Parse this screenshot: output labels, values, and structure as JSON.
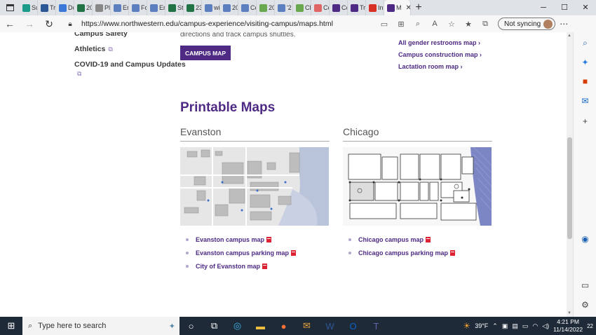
{
  "browser": {
    "tabs": [
      {
        "label": "Su",
        "color": "#1a9b8a"
      },
      {
        "label": "Tri",
        "color": "#2b5797"
      },
      {
        "label": "Dc",
        "color": "#3c78d8"
      },
      {
        "label": "20",
        "color": "#217346"
      },
      {
        "label": "Pl",
        "color": "#888888"
      },
      {
        "label": "En",
        "color": "#5b7fbf"
      },
      {
        "label": "Fo",
        "color": "#5b7fbf"
      },
      {
        "label": "En",
        "color": "#5b7fbf"
      },
      {
        "label": "St",
        "color": "#217346"
      },
      {
        "label": "23",
        "color": "#217346"
      },
      {
        "label": "wi",
        "color": "#5b7fbf"
      },
      {
        "label": "20",
        "color": "#5b7fbf"
      },
      {
        "label": "Cc",
        "color": "#5b7fbf"
      },
      {
        "label": "20",
        "color": "#6aa84f"
      },
      {
        "label": "'2",
        "color": "#5b7fbf"
      },
      {
        "label": "Cl",
        "color": "#6aa84f"
      },
      {
        "label": "Cc",
        "color": "#e06666"
      },
      {
        "label": "Cc",
        "color": "#4e2a84"
      },
      {
        "label": "Tri",
        "color": "#4e2a84"
      },
      {
        "label": "In",
        "color": "#d93025"
      }
    ],
    "active_tab": {
      "label": "M",
      "color": "#4e2a84"
    },
    "url": "https://www.northwestern.edu/campus-experience/visiting-campus/maps.html",
    "sync_label": "Not syncing"
  },
  "page": {
    "side_links": [
      "Campus Safety",
      "Athletics",
      "COVID-19 and Campus Updates"
    ],
    "desc_text": "directions and track campus shuttles.",
    "campus_map_button": "CAMPUS MAP",
    "right_links": [
      "All gender restrooms map",
      "Campus construction map",
      "Lactation room map"
    ],
    "section_title": "Printable Maps",
    "evanston": {
      "title": "Evanston",
      "links": [
        "Evanston campus map",
        "Evanston campus parking map",
        "City of Evanston map"
      ]
    },
    "chicago": {
      "title": "Chicago",
      "links": [
        "Chicago campus map",
        "Chicago campus parking map"
      ]
    }
  },
  "taskbar": {
    "search_placeholder": "Type here to search",
    "weather": "39°F",
    "time": "4:21 PM",
    "date": "11/14/2022",
    "notifications": "22"
  }
}
